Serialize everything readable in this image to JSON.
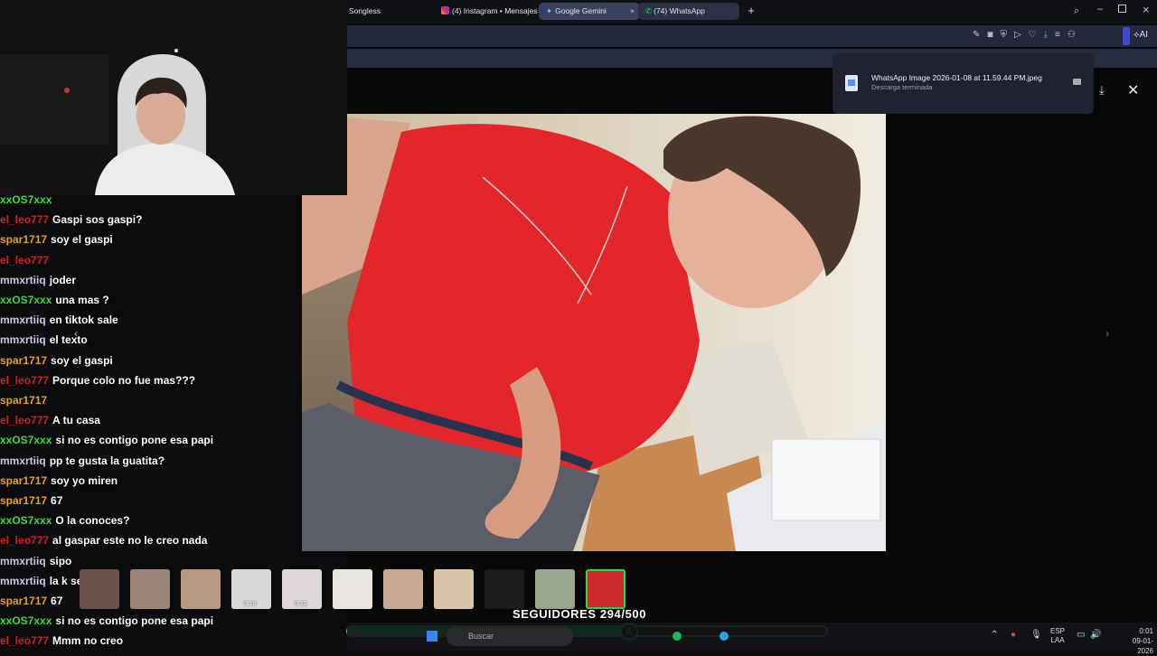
{
  "browser": {
    "tabs": [
      {
        "label": "Songless",
        "active": false
      },
      {
        "label": "(4) Instagram • Mensajes",
        "active": false
      },
      {
        "label": "Google Gemini",
        "active": true
      },
      {
        "label": "(74) WhatsApp",
        "active": false
      }
    ],
    "toolbar_ai_label": "AI"
  },
  "download": {
    "filename": "WhatsApp Image 2026-01-08 at 11.59.44 PM.jpeg",
    "status": "Descarga terminada"
  },
  "chat": [
    {
      "user": "xxOS7xxx",
      "color": "#3ddc3d",
      "msg": ""
    },
    {
      "user": "el_leo777",
      "color": "#d81e1e",
      "msg": "Gaspi sos gaspi?"
    },
    {
      "user": "spar1717",
      "color": "#e6a21c",
      "msg": "soy el gaspi"
    },
    {
      "user": "el_leo777",
      "color": "#d81e1e",
      "msg": ""
    },
    {
      "user": "mmxrtiiq",
      "color": "#c8c8e8",
      "msg": "joder"
    },
    {
      "user": "xxOS7xxx",
      "color": "#3ddc3d",
      "msg": "una mas ?"
    },
    {
      "user": "mmxrtiiq",
      "color": "#c8c8e8",
      "msg": "en tiktok sale"
    },
    {
      "user": "mmxrtiiq",
      "color": "#c8c8e8",
      "msg": "el texto"
    },
    {
      "user": "spar1717",
      "color": "#e6a21c",
      "msg": "soy el gaspi"
    },
    {
      "user": "el_leo777",
      "color": "#d81e1e",
      "msg": "Porque colo no fue mas???"
    },
    {
      "user": "spar1717",
      "color": "#e6a21c",
      "msg": ""
    },
    {
      "user": "el_leo777",
      "color": "#d81e1e",
      "msg": "A tu casa"
    },
    {
      "user": "xxOS7xxx",
      "color": "#3ddc3d",
      "msg": "si no es contigo pone esa papi"
    },
    {
      "user": "mmxrtiiq",
      "color": "#c8c8e8",
      "msg": "pp te gusta la guatita?"
    },
    {
      "user": "spar1717",
      "color": "#e6a21c",
      "msg": "soy yo miren"
    },
    {
      "user": "spar1717",
      "color": "#e6a21c",
      "msg": "67"
    },
    {
      "user": "xxOS7xxx",
      "color": "#3ddc3d",
      "msg": "O la conoces?"
    },
    {
      "user": "el_leo777",
      "color": "#d81e1e",
      "msg": "al gaspar este no le creo nada"
    },
    {
      "user": "mmxrtiiq",
      "color": "#c8c8e8",
      "msg": "sipo"
    },
    {
      "user": "mmxrtiiq",
      "color": "#c8c8e8",
      "msg": "la k se come"
    },
    {
      "user": "spar1717",
      "color": "#e6a21c",
      "msg": "67"
    },
    {
      "user": "xxOS7xxx",
      "color": "#3ddc3d",
      "msg": "si no es contigo pone esa papi"
    },
    {
      "user": "el_leo777",
      "color": "#d81e1e",
      "msg": "Mmm no creo"
    }
  ],
  "thumbnails": [
    {
      "label": "",
      "color": "#6a5048"
    },
    {
      "label": "",
      "color": "#9a8478"
    },
    {
      "label": "",
      "color": "#b89a84"
    },
    {
      "label": "0:18",
      "color": "#d8d8d8"
    },
    {
      "label": "0:12",
      "color": "#e0d8d8"
    },
    {
      "label": "",
      "color": "#e8e4e0"
    },
    {
      "label": "",
      "color": "#c8a890"
    },
    {
      "label": "",
      "color": "#d8c4a8"
    },
    {
      "label": "",
      "color": "#1c1c1c"
    },
    {
      "label": "",
      "color": "#9aa890"
    },
    {
      "label": "",
      "color": "#cc2a2a",
      "selected": true
    }
  ],
  "followers": {
    "label": "SEGUIDORES 294/500",
    "current": 294,
    "goal": 500,
    "progress": 0.588
  },
  "taskbar": {
    "search_placeholder": "Buscar",
    "lang": "ESP",
    "region": "LAA",
    "time": "0:01",
    "date": "09-01-2026"
  },
  "colors": {
    "accent_green": "#22e04a",
    "tab_active": "#3a4160"
  }
}
